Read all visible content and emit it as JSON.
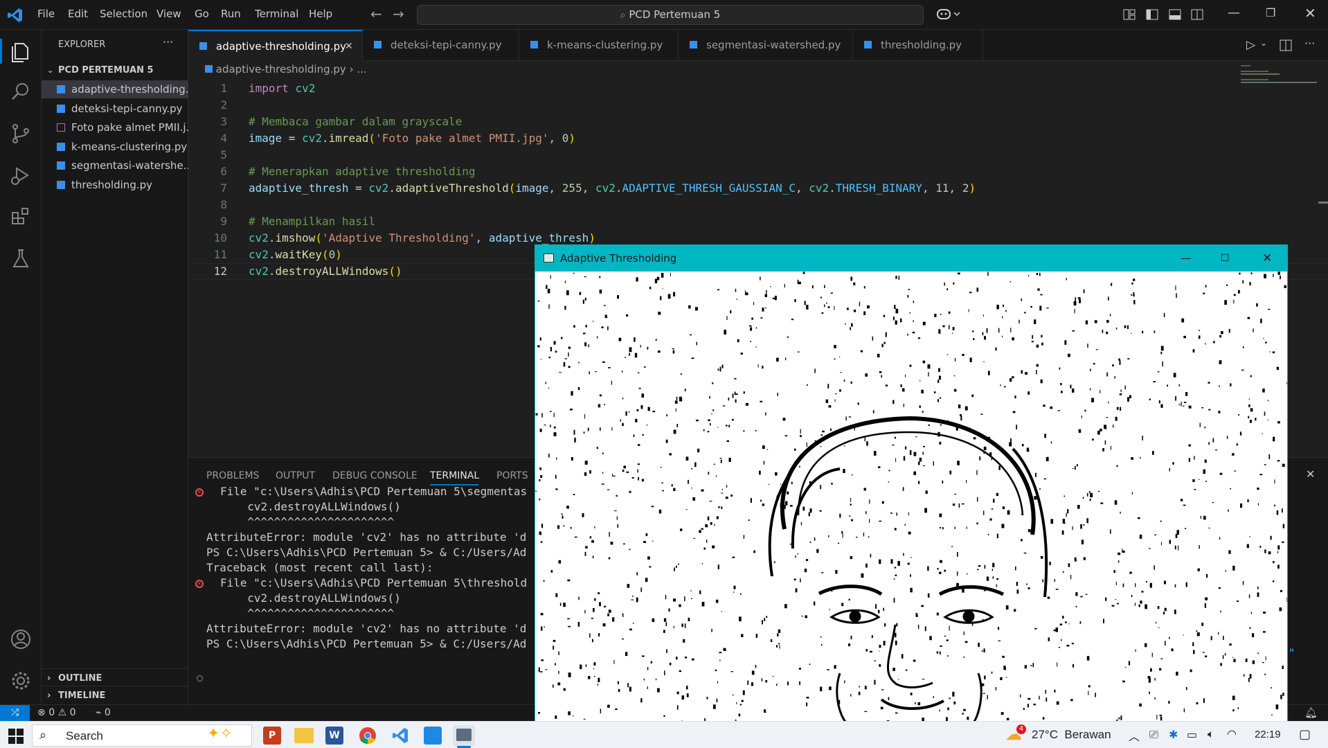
{
  "menu": [
    "File",
    "Edit",
    "Selection",
    "View",
    "Go",
    "Run",
    "Terminal",
    "Help"
  ],
  "search": {
    "text": "PCD Pertemuan 5"
  },
  "explorer": {
    "title": "EXPLORER",
    "folder": "PCD PERTEMUAN 5",
    "files": [
      "adaptive-thresholding....",
      "deteksi-tepi-canny.py",
      "Foto pake almet PMII.j...",
      "k-means-clustering.py",
      "segmentasi-watershe...",
      "thresholding.py"
    ],
    "outline": "OUTLINE",
    "timeline": "TIMELINE"
  },
  "tabs": [
    "adaptive-thresholding.py",
    "deteksi-tepi-canny.py",
    "k-means-clustering.py",
    "segmentasi-watershed.py",
    "thresholding.py"
  ],
  "breadcrumb": {
    "file": "adaptive-thresholding.py",
    "rest": "..."
  },
  "code": {
    "lines": [
      "1",
      "2",
      "3",
      "4",
      "5",
      "6",
      "7",
      "8",
      "9",
      "10",
      "11",
      "12"
    ],
    "l1": {
      "kw": "import",
      "mod": "cv2"
    },
    "l3": "# Membaca gambar dalam grayscale",
    "l4": {
      "var": "image",
      "eq": " = ",
      "mod": "cv2",
      "dot": ".",
      "fn": "imread",
      "open": "(",
      "str": "'Foto pake almet PMII.jpg'",
      "sep": ", ",
      "num": "0",
      "close": ")"
    },
    "l6": "# Menerapkan adaptive thresholding",
    "l7": {
      "var": "adaptive_thresh",
      "eq": " = ",
      "mod": "cv2",
      "dot": ".",
      "fn": "adaptiveThreshold",
      "open": "(",
      "a1": "image",
      "s1": ", ",
      "n1": "255",
      "s2": ", ",
      "m2": "cv2",
      "d2": ".",
      "c1": "ADAPTIVE_THRESH_GAUSSIAN_C",
      "s3": ", ",
      "m3": "cv2",
      "d3": ".",
      "c2": "THRESH_BINARY",
      "s4": ", ",
      "n2": "11",
      "s5": ", ",
      "n3": "2",
      "close": ")"
    },
    "l9": "# Menampilkan hasil",
    "l10": {
      "mod": "cv2",
      "dot": ".",
      "fn": "imshow",
      "open": "(",
      "str": "'Adaptive Thresholding'",
      "sep": ", ",
      "var": "adaptive_thresh",
      "close": ")"
    },
    "l11": {
      "mod": "cv2",
      "dot": ".",
      "fn": "waitKey",
      "open": "(",
      "num": "0",
      "close": ")"
    },
    "l12": {
      "mod": "cv2",
      "dot": ".",
      "fn": "destroyALLWindows",
      "open": "(",
      "close": ")"
    }
  },
  "panel": {
    "tabs": [
      "PROBLEMS",
      "OUTPUT",
      "DEBUG CONSOLE",
      "TERMINAL",
      "PORTS"
    ],
    "terminal": [
      "File \"c:\\Users\\Adhis\\PCD Pertemuan 5\\segmentas",
      "  cv2.destroyALLWindows()",
      "  ^^^^^^^^^^^^^^^^^^^^^^",
      "AttributeError: module 'cv2' has no attribute 'd",
      "PS C:\\Users\\Adhis\\PCD Pertemuan 5> & C:/Users/Ad",
      "Traceback (most recent call last):",
      "File \"c:\\Users\\Adhis\\PCD Pertemuan 5\\threshold",
      "  cv2.destroyALLWindows()",
      "  ^^^^^^^^^^^^^^^^^^^^^^",
      "AttributeError: module 'cv2' has no attribute 'd",
      "PS C:\\Users\\Adhis\\PCD Pertemuan 5> & C:/Users/Ad"
    ],
    "overflow_text": ".py\""
  },
  "status": {
    "errors": "0",
    "warnings": "0",
    "ports": "0"
  },
  "cvwindow": {
    "title": "Adaptive Thresholding"
  },
  "taskbar": {
    "search": "Search",
    "weather": "27°C  Berawan",
    "weather_badge": "4",
    "time": "22:19"
  },
  "colors": {
    "accent": "#0078d4",
    "cv_title": "#00b7c3"
  }
}
